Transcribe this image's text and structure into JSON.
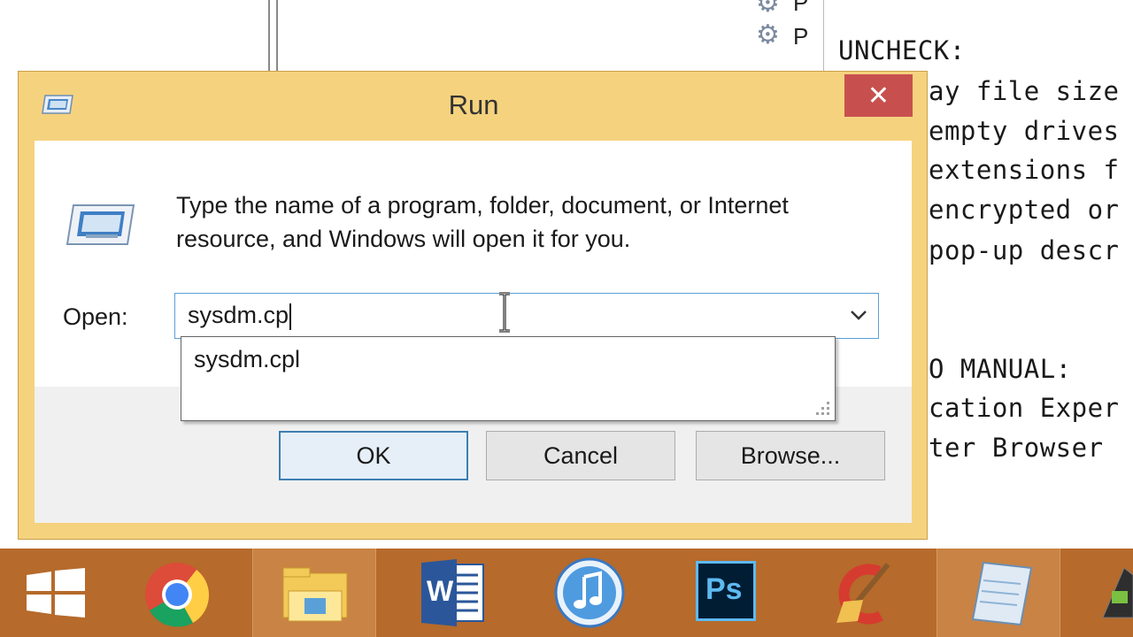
{
  "dialog": {
    "title": "Run",
    "close_glyph": "✕",
    "description": "Type the name of a program, folder, document, or Internet resource, and Windows will open it for you.",
    "open_label": "Open:",
    "open_value": "sysdm.cp",
    "suggestion": "sysdm.cpl",
    "buttons": {
      "ok": "OK",
      "cancel": "Cancel",
      "browse": "Browse..."
    }
  },
  "notepad": {
    "lines": [
      "UNCHECK:",
      "ay file size",
      "empty drives",
      "extensions f",
      "encrypted or",
      "pop-up descr",
      "O MANUAL:",
      "cation Exper",
      "ter Browser"
    ]
  },
  "background": {
    "gear_letters": [
      "P",
      "P"
    ]
  },
  "taskbar": {
    "items": [
      "start-icon",
      "chrome-icon",
      "file-explorer-icon",
      "word-icon",
      "itunes-icon",
      "photoshop-icon",
      "ccleaner-icon",
      "notepad-icon",
      "app-icon"
    ],
    "ps_label": "Ps",
    "word_label": "W"
  },
  "colors": {
    "accent": "#f5d27e",
    "close": "#c7504f",
    "taskbar": "#b66a2b",
    "focus": "#3c7fb1"
  }
}
